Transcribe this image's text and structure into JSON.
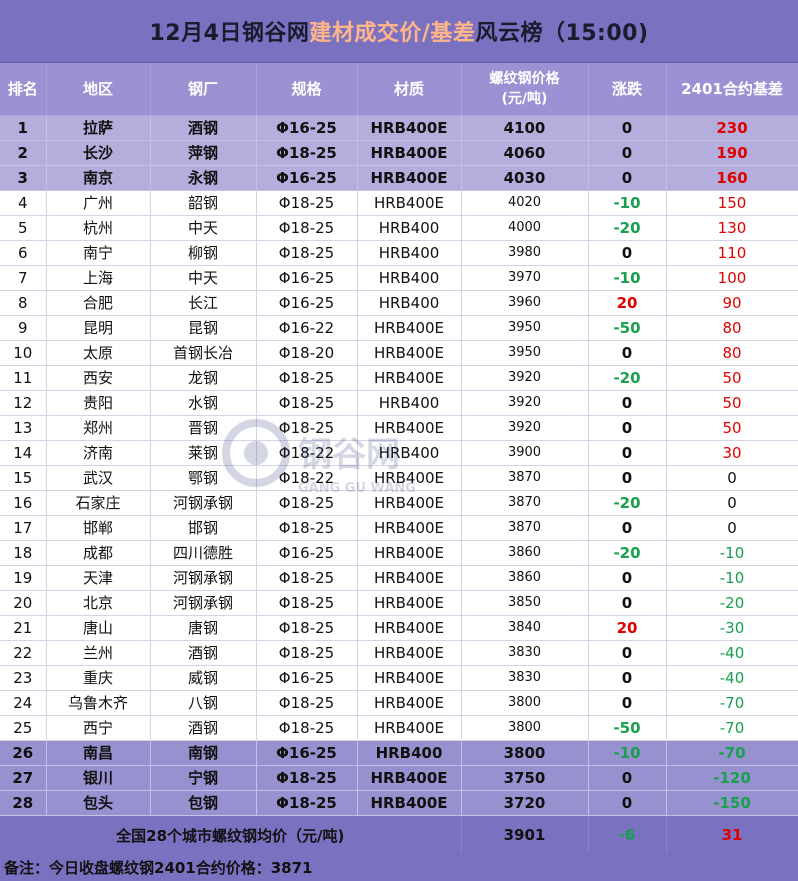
{
  "title": {
    "prefix": "12月4日钢谷网",
    "highlight": "建材成交价/基差",
    "suffix": "风云榜（15:00)"
  },
  "columns": [
    "排名",
    "地区",
    "钢厂",
    "规格",
    "材质",
    "螺纹钢价格\n(元/吨)",
    "涨跌",
    "2401合约基差"
  ],
  "rows": [
    {
      "rank": "1",
      "city": "拉萨",
      "mill": "酒钢",
      "spec": "Φ16-25",
      "grade": "HRB400E",
      "price": "4100",
      "change": "0",
      "basis": "230"
    },
    {
      "rank": "2",
      "city": "长沙",
      "mill": "萍钢",
      "spec": "Φ18-25",
      "grade": "HRB400E",
      "price": "4060",
      "change": "0",
      "basis": "190"
    },
    {
      "rank": "3",
      "city": "南京",
      "mill": "永钢",
      "spec": "Φ16-25",
      "grade": "HRB400E",
      "price": "4030",
      "change": "0",
      "basis": "160"
    },
    {
      "rank": "4",
      "city": "广州",
      "mill": "韶钢",
      "spec": "Φ18-25",
      "grade": "HRB400E",
      "price": "4020",
      "change": "-10",
      "basis": "150"
    },
    {
      "rank": "5",
      "city": "杭州",
      "mill": "中天",
      "spec": "Φ18-25",
      "grade": "HRB400",
      "price": "4000",
      "change": "-20",
      "basis": "130"
    },
    {
      "rank": "6",
      "city": "南宁",
      "mill": "柳钢",
      "spec": "Φ18-25",
      "grade": "HRB400",
      "price": "3980",
      "change": "0",
      "basis": "110"
    },
    {
      "rank": "7",
      "city": "上海",
      "mill": "中天",
      "spec": "Φ16-25",
      "grade": "HRB400",
      "price": "3970",
      "change": "-10",
      "basis": "100"
    },
    {
      "rank": "8",
      "city": "合肥",
      "mill": "长江",
      "spec": "Φ16-25",
      "grade": "HRB400",
      "price": "3960",
      "change": "20",
      "basis": "90"
    },
    {
      "rank": "9",
      "city": "昆明",
      "mill": "昆钢",
      "spec": "Φ16-22",
      "grade": "HRB400E",
      "price": "3950",
      "change": "-50",
      "basis": "80"
    },
    {
      "rank": "10",
      "city": "太原",
      "mill": "首钢长冶",
      "spec": "Φ18-20",
      "grade": "HRB400E",
      "price": "3950",
      "change": "0",
      "basis": "80"
    },
    {
      "rank": "11",
      "city": "西安",
      "mill": "龙钢",
      "spec": "Φ18-25",
      "grade": "HRB400E",
      "price": "3920",
      "change": "-20",
      "basis": "50"
    },
    {
      "rank": "12",
      "city": "贵阳",
      "mill": "水钢",
      "spec": "Φ18-25",
      "grade": "HRB400",
      "price": "3920",
      "change": "0",
      "basis": "50"
    },
    {
      "rank": "13",
      "city": "郑州",
      "mill": "晋钢",
      "spec": "Φ18-25",
      "grade": "HRB400E",
      "price": "3920",
      "change": "0",
      "basis": "50"
    },
    {
      "rank": "14",
      "city": "济南",
      "mill": "莱钢",
      "spec": "Φ18-22",
      "grade": "HRB400",
      "price": "3900",
      "change": "0",
      "basis": "30"
    },
    {
      "rank": "15",
      "city": "武汉",
      "mill": "鄂钢",
      "spec": "Φ18-22",
      "grade": "HRB400E",
      "price": "3870",
      "change": "0",
      "basis": "0"
    },
    {
      "rank": "16",
      "city": "石家庄",
      "mill": "河钢承钢",
      "spec": "Φ18-25",
      "grade": "HRB400E",
      "price": "3870",
      "change": "-20",
      "basis": "0"
    },
    {
      "rank": "17",
      "city": "邯郸",
      "mill": "邯钢",
      "spec": "Φ18-25",
      "grade": "HRB400E",
      "price": "3870",
      "change": "0",
      "basis": "0"
    },
    {
      "rank": "18",
      "city": "成都",
      "mill": "四川德胜",
      "spec": "Φ16-25",
      "grade": "HRB400E",
      "price": "3860",
      "change": "-20",
      "basis": "-10"
    },
    {
      "rank": "19",
      "city": "天津",
      "mill": "河钢承钢",
      "spec": "Φ18-25",
      "grade": "HRB400E",
      "price": "3860",
      "change": "0",
      "basis": "-10"
    },
    {
      "rank": "20",
      "city": "北京",
      "mill": "河钢承钢",
      "spec": "Φ18-25",
      "grade": "HRB400E",
      "price": "3850",
      "change": "0",
      "basis": "-20"
    },
    {
      "rank": "21",
      "city": "唐山",
      "mill": "唐钢",
      "spec": "Φ18-25",
      "grade": "HRB400E",
      "price": "3840",
      "change": "20",
      "basis": "-30"
    },
    {
      "rank": "22",
      "city": "兰州",
      "mill": "酒钢",
      "spec": "Φ18-25",
      "grade": "HRB400E",
      "price": "3830",
      "change": "0",
      "basis": "-40"
    },
    {
      "rank": "23",
      "city": "重庆",
      "mill": "威钢",
      "spec": "Φ16-25",
      "grade": "HRB400E",
      "price": "3830",
      "change": "0",
      "basis": "-40"
    },
    {
      "rank": "24",
      "city": "乌鲁木齐",
      "mill": "八钢",
      "spec": "Φ18-25",
      "grade": "HRB400E",
      "price": "3800",
      "change": "0",
      "basis": "-70"
    },
    {
      "rank": "25",
      "city": "西宁",
      "mill": "酒钢",
      "spec": "Φ18-25",
      "grade": "HRB400E",
      "price": "3800",
      "change": "-50",
      "basis": "-70"
    },
    {
      "rank": "26",
      "city": "南昌",
      "mill": "南钢",
      "spec": "Φ16-25",
      "grade": "HRB400",
      "price": "3800",
      "change": "-10",
      "basis": "-70"
    },
    {
      "rank": "27",
      "city": "银川",
      "mill": "宁钢",
      "spec": "Φ18-25",
      "grade": "HRB400E",
      "price": "3750",
      "change": "0",
      "basis": "-120"
    },
    {
      "rank": "28",
      "city": "包头",
      "mill": "包钢",
      "spec": "Φ18-25",
      "grade": "HRB400E",
      "price": "3720",
      "change": "0",
      "basis": "-150"
    }
  ],
  "summary": {
    "label": "全国28个城市螺纹钢均价（元/吨)",
    "price": "3901",
    "change": "-6",
    "basis": "31"
  },
  "footnote": "备注：今日收盘螺纹钢2401合约价格：3871",
  "watermark": {
    "cn": "钢谷网",
    "en": "GANG GU WANG"
  },
  "colors": {
    "header": "#7b71c1",
    "top_rows": "#b3aedc",
    "bottom_rows": "#9891cf",
    "up": "#e00000",
    "down": "#17a04d",
    "title_accent": "#ffb58a"
  }
}
